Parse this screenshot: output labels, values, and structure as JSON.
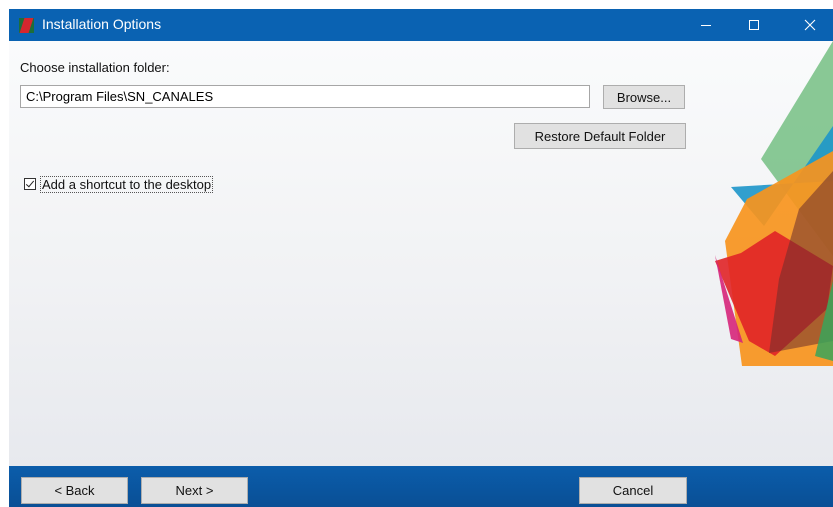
{
  "window": {
    "title": "Installation Options",
    "controls": {
      "minimize": "—",
      "maximize": "☐",
      "close": "✕"
    },
    "titlebar_color": "#0a62b2"
  },
  "folder": {
    "label": "Choose installation folder:",
    "path_value": "C:\\Program Files\\SN_CANALES",
    "browse_label": "Browse...",
    "restore_label": "Restore Default Folder"
  },
  "shortcut": {
    "label": "Add a shortcut to the desktop",
    "checked": true
  },
  "footer": {
    "back_label": "< Back",
    "next_label": "Next >",
    "cancel_label": "Cancel",
    "bar_color": "#0b5dab"
  },
  "decor_colors": [
    "#7cc28a",
    "#1d96c9",
    "#f7941d",
    "#e02427",
    "#d6257a",
    "#6b2d2d"
  ]
}
